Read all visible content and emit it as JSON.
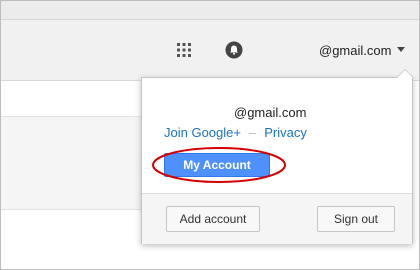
{
  "header": {
    "account_label": "@gmail.com",
    "apps_icon": "apps-grid-icon",
    "notifications_icon": "notifications-icon",
    "caret_icon": "caret-down-icon"
  },
  "popup": {
    "email": "@gmail.com",
    "join_link": "Join Google+",
    "separator": "–",
    "privacy_link": "Privacy",
    "my_account_button": "My Account",
    "add_account_button": "Add account",
    "sign_out_button": "Sign out"
  },
  "colors": {
    "accent_button": "#4d90fe",
    "link": "#1a73c9",
    "annotation": "#d40000"
  }
}
